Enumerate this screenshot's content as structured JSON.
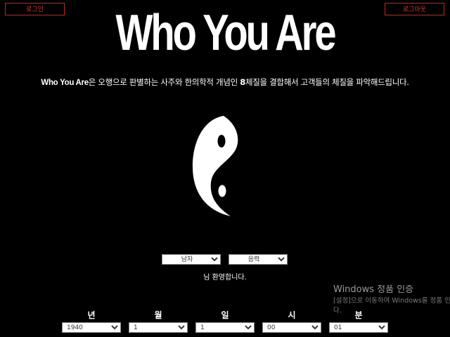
{
  "header": {
    "login_label": "로그인",
    "logout_label": "로그아웃",
    "title": "Who You Are"
  },
  "description": {
    "brand": "Who You Are",
    "part1": "은 오행으로 판별하는 사주와 한의학적 개념인 ",
    "number": "8",
    "part2": "체질을 결합해서 고객들의 체질을 파악해드립니다."
  },
  "form": {
    "gender": {
      "selected": "남자"
    },
    "calendar": {
      "selected": "음력"
    },
    "welcome": "님 환영합니다.",
    "fields": [
      {
        "label": "년",
        "selected": "1940"
      },
      {
        "label": "월",
        "selected": "1"
      },
      {
        "label": "일",
        "selected": "1"
      },
      {
        "label": "시",
        "selected": "00"
      },
      {
        "label": "분",
        "selected": "01"
      }
    ]
  },
  "watermark": {
    "title": "Windows 정품 인증",
    "line1": "[설정]으로 이동하여 Windows를 정품 인증합",
    "line2": "다."
  },
  "colors": {
    "background": "#000000",
    "accent_red": "#c2281f",
    "text": "#ffffff"
  }
}
